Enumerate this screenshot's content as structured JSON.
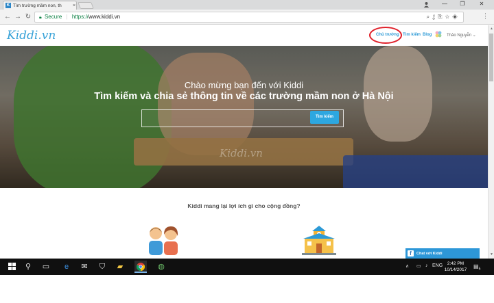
{
  "browser": {
    "tab_title": "Tìm trường mầm non, th",
    "tab_close": "×",
    "favicon_letter": "K",
    "secure_label": "Secure",
    "url_scheme": "https://",
    "url_host": "www.kiddi.vn",
    "win_minimize": "—",
    "win_restore": "❐",
    "win_close": "✕"
  },
  "site": {
    "logo": "Kiddi.vn",
    "nav": {
      "owner": "Chủ trường",
      "search": "Tìm kiếm",
      "blog": "Blog",
      "user": "Thảo Nguyễn ⌄"
    }
  },
  "hero": {
    "welcome": "Chào mừng bạn đến với Kiddi",
    "tagline": "Tìm kiếm và chia sẻ thông tin về các trường mầm non ở Hà Nội",
    "search_button": "Tìm kiếm",
    "search_placeholder": "",
    "watermark": "Kiddi.vn"
  },
  "content": {
    "section_title": "Kiddi mang lại lợi ích gì cho cộng đồng?"
  },
  "chat": {
    "fb_letter": "f",
    "label": "Chat với Kiddi"
  },
  "taskbar": {
    "language": "ENG",
    "time": "2:42 PM",
    "date": "10/14/2017",
    "notification_count": "5"
  },
  "colors": {
    "brand_blue": "#2d9ad6",
    "highlight_red": "#e0202a",
    "taskbar": "#101010"
  }
}
